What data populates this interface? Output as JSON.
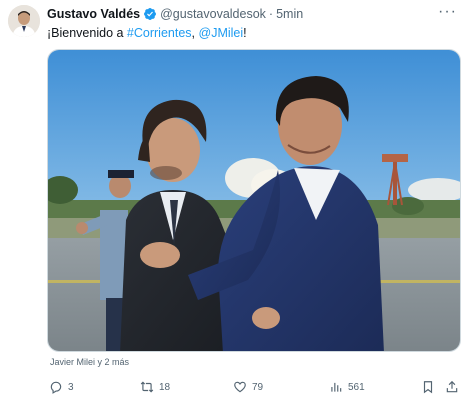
{
  "author": {
    "name": "Gustavo Valdés",
    "handle": "@gustavovaldesok",
    "separator": "·",
    "time": "5min"
  },
  "tweet": {
    "prefix": "¡Bienvenido a ",
    "hashtag": "#Corrientes",
    "comma": ", ",
    "mention": "@JMilei",
    "suffix": "!"
  },
  "media": {
    "tagged": "Javier Milei y 2 más"
  },
  "actions": {
    "replies": "3",
    "reposts": "18",
    "likes": "79",
    "views": "561"
  },
  "icons": {
    "verified": "verified-badge-icon",
    "more": "more-icon",
    "reply": "reply-icon",
    "repost": "repost-icon",
    "like": "heart-icon",
    "views": "views-icon",
    "bookmark": "bookmark-icon",
    "share": "share-icon"
  },
  "colors": {
    "link": "#1d9bf0",
    "muted": "#536471",
    "text": "#0f1419"
  }
}
